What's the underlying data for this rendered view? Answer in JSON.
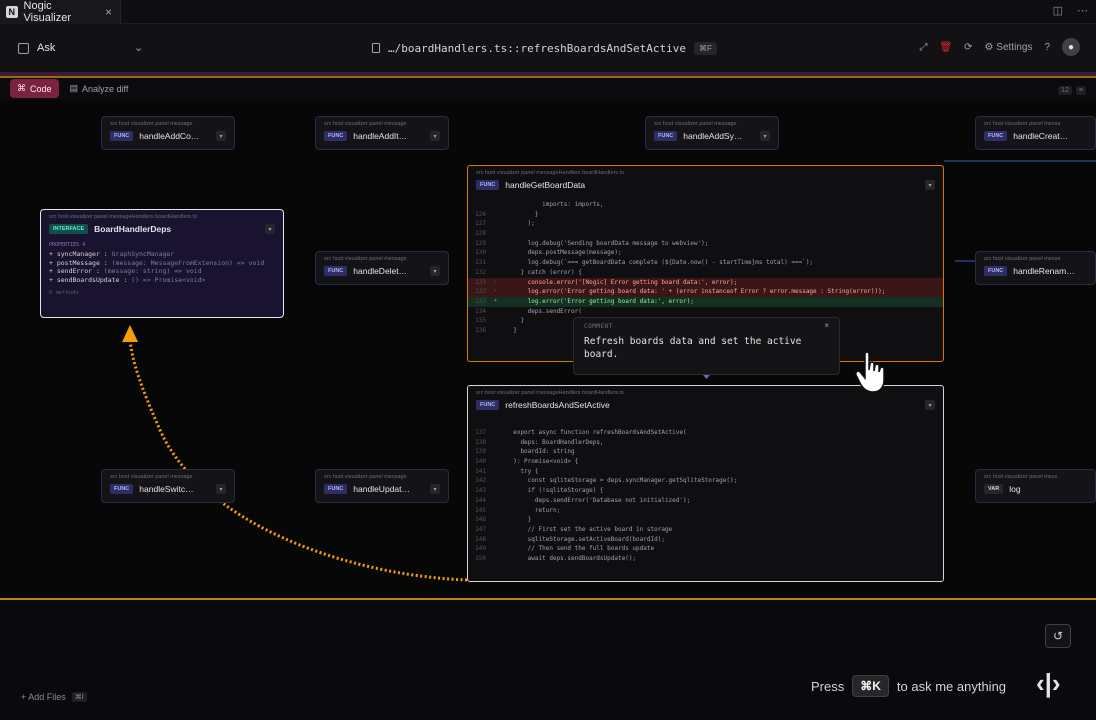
{
  "tab": {
    "title": "Nogic Visualizer",
    "close": "×"
  },
  "header": {
    "ask_label": "Ask",
    "chevron": "⌄",
    "file_path": "…/boardHandlers.ts::refreshBoardsAndSetActive",
    "file_shortcut": "⌘F",
    "settings_label": "Settings"
  },
  "toolbar": {
    "code_label": "Code",
    "analyze_label": "Analyze diff",
    "count": "12"
  },
  "nodes": [
    {
      "path": "src  host  visualizer  panel  message",
      "badge": "FUNC",
      "name": "handleAddCo…"
    },
    {
      "path": "src  host  visualizer  panel  message",
      "badge": "FUNC",
      "name": "handleAddIt…"
    },
    {
      "path": "src  host  visualizer  panel  message",
      "badge": "FUNC",
      "name": "handleAddSy…"
    },
    {
      "path": "src  host  visualizer  panel  messa",
      "badge": "FUNC",
      "name": "handleCreat…"
    },
    {
      "path": "src  host  visualizer  panel  message",
      "badge": "FUNC",
      "name": "handleDelet…"
    },
    {
      "path": "src  host  visualizer  panel  messa",
      "badge": "FUNC",
      "name": "handleRenam…"
    },
    {
      "path": "src  host  visualizer  panel  message",
      "badge": "FUNC",
      "name": "handleSwitc…"
    },
    {
      "path": "src  host  visualizer  panel  message",
      "badge": "FUNC",
      "name": "handleUpdat…"
    },
    {
      "path": "src  host  visualizer  panel  mess",
      "badge": "VAR",
      "name": "log"
    }
  ],
  "iface": {
    "path": "src  host  visualizer  panel  messageHandlers  boardHandlers.ts",
    "badge": "INTERFACE",
    "name": "BoardHandlerDeps",
    "props_label": "PROPERTIES   4",
    "props": [
      {
        "name": "+ syncManager : ",
        "type": "GraphSyncManager"
      },
      {
        "name": "+ postMessage : ",
        "type": "(message: MessageFromExtension) => void"
      },
      {
        "name": "+ sendError : ",
        "type": "(message: string) => void"
      },
      {
        "name": "+ sendBoardsUpdate : ",
        "type": "() => Promise<void>"
      }
    ],
    "footer": "0 methods"
  },
  "get_board": {
    "path": "src  host  visualizer  panel  messageHandlers  boardHandlers.ts",
    "badge": "FUNC",
    "name": "handleGetBoardData",
    "lines": [
      {
        "n": "",
        "m": "",
        "t": "          imports: imports,",
        "k": ""
      },
      {
        "n": "126",
        "m": "",
        "t": "        }",
        "k": ""
      },
      {
        "n": "127",
        "m": "",
        "t": "      );",
        "k": ""
      },
      {
        "n": "128",
        "m": "",
        "t": "",
        "k": ""
      },
      {
        "n": "129",
        "m": "",
        "t": "      log.debug('Sending boardData message to webview');",
        "k": ""
      },
      {
        "n": "130",
        "m": "",
        "t": "      deps.postMessage(message);",
        "k": ""
      },
      {
        "n": "131",
        "m": "",
        "t": "      log.debug(`=== getBoardData complete (${Date.now() - startTime}ms total) ===`);",
        "k": ""
      },
      {
        "n": "132",
        "m": "",
        "t": "    } catch (error) {",
        "k": ""
      },
      {
        "n": "133",
        "m": "-",
        "t": "      console.error('[Nogic] Error getting board data:', error);",
        "k": "del"
      },
      {
        "n": "133",
        "m": "-",
        "t": "      log.error('Error getting board data: ' + (error instanceof Error ? error.message : String(error)));",
        "k": "del"
      },
      {
        "n": "133",
        "m": "+",
        "t": "      log.error('Error getting board data:', error);",
        "k": "add"
      },
      {
        "n": "134",
        "m": "",
        "t": "      deps.sendError(",
        "k": ""
      },
      {
        "n": "135",
        "m": "",
        "t": "    }",
        "k": ""
      },
      {
        "n": "136",
        "m": "",
        "t": "  }",
        "k": ""
      }
    ]
  },
  "refresh": {
    "path": "src  host  visualizer  panel  messageHandlers  boardHandlers.ts",
    "badge": "FUNC",
    "name": "refreshBoardsAndSetActive",
    "lines": [
      {
        "n": "137",
        "m": "",
        "t": "  export async function refreshBoardsAndSetActive(",
        "k": ""
      },
      {
        "n": "138",
        "m": "",
        "t": "    deps: BoardHandlerDeps,",
        "k": ""
      },
      {
        "n": "139",
        "m": "",
        "t": "    boardId: string",
        "k": ""
      },
      {
        "n": "140",
        "m": "",
        "t": "  ): Promise<void> {",
        "k": ""
      },
      {
        "n": "141",
        "m": "",
        "t": "    try {",
        "k": ""
      },
      {
        "n": "142",
        "m": "",
        "t": "      const sqliteStorage = deps.syncManager.getSqliteStorage();",
        "k": ""
      },
      {
        "n": "143",
        "m": "",
        "t": "      if (!sqliteStorage) {",
        "k": ""
      },
      {
        "n": "144",
        "m": "",
        "t": "        deps.sendError('Database not initialized');",
        "k": ""
      },
      {
        "n": "145",
        "m": "",
        "t": "        return;",
        "k": ""
      },
      {
        "n": "146",
        "m": "",
        "t": "      }",
        "k": ""
      },
      {
        "n": "147",
        "m": "",
        "t": "      // First set the active board in storage",
        "k": ""
      },
      {
        "n": "148",
        "m": "",
        "t": "      sqliteStorage.setActiveBoard(boardId);",
        "k": ""
      },
      {
        "n": "149",
        "m": "",
        "t": "      // Then send the full boards update",
        "k": ""
      },
      {
        "n": "150",
        "m": "",
        "t": "      await deps.sendBoardsUpdate();",
        "k": ""
      }
    ]
  },
  "comment": {
    "label": "COMMENT",
    "close": "×",
    "text": "Refresh boards data and set the active board."
  },
  "footer": {
    "add_files": "+ Add Files",
    "add_files_shortcut": "⌘I",
    "press": "Press",
    "shortcut": "⌘K",
    "hint": "to ask me anything"
  },
  "colors": {
    "accent_orange": "#d97706",
    "code_button": "#7a2340",
    "edge_orange": "#f59e0b"
  }
}
